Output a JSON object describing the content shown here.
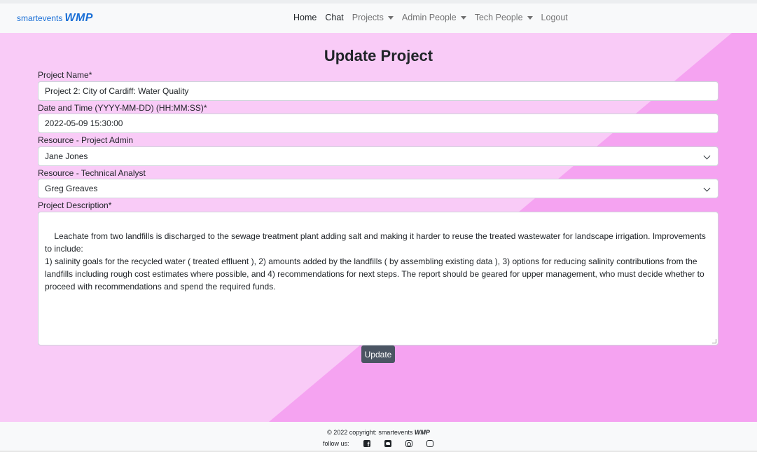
{
  "brand": {
    "text": "smartevents",
    "logo": "WMP"
  },
  "nav": {
    "home": "Home",
    "chat": "Chat",
    "projects": "Projects",
    "admin_people": "Admin People",
    "tech_people": "Tech People",
    "logout": "Logout"
  },
  "form": {
    "title": "Update Project",
    "project_name_label": "Project Name*",
    "project_name_value": "Project 2: City of Cardiff: Water Quality",
    "datetime_label": "Date and Time (YYYY-MM-DD) (HH:MM:SS)*",
    "datetime_value": "2022-05-09 15:30:00",
    "admin_label": "Resource - Project Admin",
    "admin_value": "Jane Jones",
    "tech_label": "Resource - Technical Analyst",
    "tech_value": "Greg Greaves",
    "description_label": "Project Description*",
    "description_value": "Leachate from two landfills is discharged to the sewage treatment plant adding salt and making it harder to reuse the treated wastewater for landscape irrigation. Improvements to include:\n1) salinity goals for the recycled water ( treated effluent ), 2) amounts added by the landfills ( by assembling existing data ), 3) options for reducing salinity contributions from the landfills including rough cost estimates where possible, and 4) recommendations for next steps. The report should be geared for upper management, who must decide whether to proceed with recommendations and spend the required funds.",
    "update_label": "Update"
  },
  "footer": {
    "copyright": "© 2022 copyright: smartevents",
    "logo": "WMP",
    "follow": "follow us:",
    "icons": [
      "facebook-icon",
      "twitter-icon",
      "instagram-icon",
      "youtube-icon"
    ]
  },
  "colors": {
    "brand": "#1a6fd6",
    "bg_light": "#f9cbf7",
    "bg_dark": "#f5a3f1",
    "button": "#4b5563"
  }
}
